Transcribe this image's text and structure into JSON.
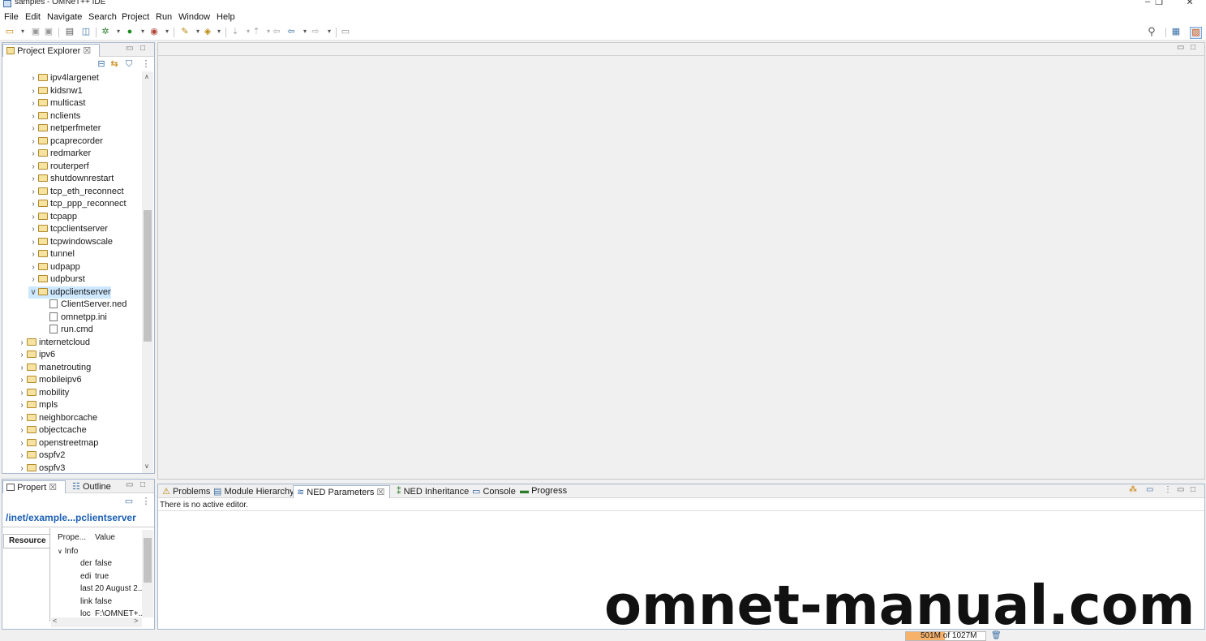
{
  "window": {
    "title": "samples - OMNeT++ IDE",
    "minimize": "–",
    "maximize": "❐",
    "close": "✕"
  },
  "menu": [
    "File",
    "Edit",
    "Navigate",
    "Search",
    "Project",
    "Run",
    "Window",
    "Help"
  ],
  "project_explorer": {
    "tab_label": "Project Explorer",
    "tab_close": "☒",
    "items": [
      {
        "label": "ipv4largenet",
        "indent": 2,
        "type": "folder",
        "expanded": false
      },
      {
        "label": "kidsnw1",
        "indent": 2,
        "type": "folder",
        "expanded": false
      },
      {
        "label": "multicast",
        "indent": 2,
        "type": "folder",
        "expanded": false
      },
      {
        "label": "nclients",
        "indent": 2,
        "type": "folder",
        "expanded": false
      },
      {
        "label": "netperfmeter",
        "indent": 2,
        "type": "folder",
        "expanded": false
      },
      {
        "label": "pcaprecorder",
        "indent": 2,
        "type": "folder",
        "expanded": false
      },
      {
        "label": "redmarker",
        "indent": 2,
        "type": "folder",
        "expanded": false
      },
      {
        "label": "routerperf",
        "indent": 2,
        "type": "folder",
        "expanded": false
      },
      {
        "label": "shutdownrestart",
        "indent": 2,
        "type": "folder",
        "expanded": false
      },
      {
        "label": "tcp_eth_reconnect",
        "indent": 2,
        "type": "folder",
        "expanded": false
      },
      {
        "label": "tcp_ppp_reconnect",
        "indent": 2,
        "type": "folder",
        "expanded": false
      },
      {
        "label": "tcpapp",
        "indent": 2,
        "type": "folder",
        "expanded": false
      },
      {
        "label": "tcpclientserver",
        "indent": 2,
        "type": "folder",
        "expanded": false
      },
      {
        "label": "tcpwindowscale",
        "indent": 2,
        "type": "folder",
        "expanded": false
      },
      {
        "label": "tunnel",
        "indent": 2,
        "type": "folder",
        "expanded": false
      },
      {
        "label": "udpapp",
        "indent": 2,
        "type": "folder",
        "expanded": false
      },
      {
        "label": "udpburst",
        "indent": 2,
        "type": "folder",
        "expanded": false
      },
      {
        "label": "udpclientserver",
        "indent": 2,
        "type": "folder",
        "expanded": true,
        "selected": true
      },
      {
        "label": "ClientServer.ned",
        "indent": 3,
        "type": "file"
      },
      {
        "label": "omnetpp.ini",
        "indent": 3,
        "type": "file"
      },
      {
        "label": "run.cmd",
        "indent": 3,
        "type": "file"
      },
      {
        "label": "internetcloud",
        "indent": 1,
        "type": "folder",
        "expanded": false
      },
      {
        "label": "ipv6",
        "indent": 1,
        "type": "folder",
        "expanded": false
      },
      {
        "label": "manetrouting",
        "indent": 1,
        "type": "folder",
        "expanded": false
      },
      {
        "label": "mobileipv6",
        "indent": 1,
        "type": "folder",
        "expanded": false
      },
      {
        "label": "mobility",
        "indent": 1,
        "type": "folder",
        "expanded": false
      },
      {
        "label": "mpls",
        "indent": 1,
        "type": "folder",
        "expanded": false
      },
      {
        "label": "neighborcache",
        "indent": 1,
        "type": "folder",
        "expanded": false
      },
      {
        "label": "objectcache",
        "indent": 1,
        "type": "folder",
        "expanded": false
      },
      {
        "label": "openstreetmap",
        "indent": 1,
        "type": "folder",
        "expanded": false
      },
      {
        "label": "ospfv2",
        "indent": 1,
        "type": "folder",
        "expanded": false
      },
      {
        "label": "ospfv3",
        "indent": 1,
        "type": "folder",
        "expanded": false
      }
    ]
  },
  "properties": {
    "tabs": [
      "Propert",
      "Outline"
    ],
    "tab_close": "☒",
    "path": "/inet/example...pclientserver",
    "side_tab": "Resource",
    "col_property": "Prope...",
    "col_value": "Value",
    "group": "Info",
    "rows": [
      {
        "key": "der",
        "value": "false"
      },
      {
        "key": "edi",
        "value": "true"
      },
      {
        "key": "last",
        "value": "20 August 2..."
      },
      {
        "key": "link",
        "value": "false"
      },
      {
        "key": "loc",
        "value": "F:\\OMNET+..."
      }
    ]
  },
  "bottom_panel": {
    "tabs": [
      "Problems",
      "Module Hierarchy",
      "NED Parameters",
      "NED Inheritance",
      "Console",
      "Progress"
    ],
    "active_tab": "NED Parameters",
    "tab_close": "☒",
    "message": "There is no active editor."
  },
  "status": {
    "heap_label": "501M of 1027M",
    "heap_fraction": 0.49
  },
  "watermark": "omnet-manual.com",
  "colors": {
    "selection": "#cde8ff",
    "heap_fill": "#f6b26b",
    "link_blue": "#1a5fb4"
  },
  "icons": [
    "new-icon",
    "save-icon",
    "debug-icon",
    "run-icon",
    "search-icon",
    "perspective-icon"
  ]
}
